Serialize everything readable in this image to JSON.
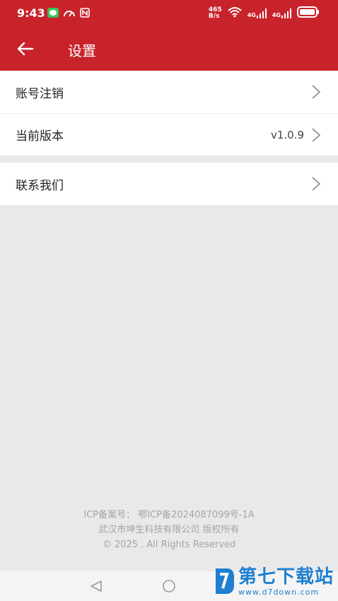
{
  "status_bar": {
    "time": "9:43",
    "net_speed_top": "465",
    "net_speed_bottom": "B/s",
    "signal1_label": "4G",
    "signal2_label": "4G"
  },
  "header": {
    "title": "设置"
  },
  "menu_group_1": {
    "items": [
      {
        "label": "账号注销",
        "value": ""
      },
      {
        "label": "当前版本",
        "value": "v1.0.9"
      }
    ]
  },
  "menu_group_2": {
    "items": [
      {
        "label": "联系我们",
        "value": ""
      }
    ]
  },
  "footer": {
    "icp": "ICP备案号：  鄂ICP备2024087099号-1A",
    "company": "武汉市坤生科技有限公司 版权所有",
    "copyright": "© 2025 . All Rights Reserved"
  },
  "watermark": {
    "main": "第七下载站",
    "sub": "www.d7down.com"
  },
  "colors": {
    "brand_red": "#c8232b",
    "watermark_blue": "#1f7fd0"
  }
}
